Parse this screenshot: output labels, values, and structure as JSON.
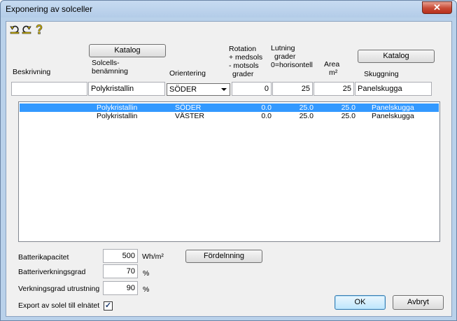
{
  "window": {
    "title": "Exponering av solceller",
    "close_label": "✕"
  },
  "toolbar": {
    "icons": [
      "undo-icon",
      "redo-icon",
      "help-icon"
    ]
  },
  "headers": {
    "katalog_left": "Katalog",
    "katalog_right": "Katalog",
    "beskrivning": "Beskrivning",
    "solcell_l1": "Solcells-",
    "solcell_l2": "benämning",
    "orientering": "Orientering",
    "rotation_l1": "Rotation",
    "rotation_l2": "+ medsols",
    "rotation_l3": "- motsols",
    "rotation_l4": "grader",
    "lutning_l1": "Lutning",
    "lutning_l2": "grader",
    "lutning_l3": "0=horisontell",
    "area_l1": "Area",
    "area_l2": "m²",
    "skuggning": "Skuggning"
  },
  "inputs": {
    "beskrivning": "",
    "solcell": "Polykristallin",
    "orientering": "SÖDER",
    "rotation": "0",
    "lutning": "25",
    "area": "25",
    "skuggning": "Panelskugga"
  },
  "rows": [
    {
      "beskrivning": "",
      "solcell": "Polykristallin",
      "orientering": "SÖDER",
      "rotation": "0.0",
      "lutning": "25.0",
      "area": "25.0",
      "skuggning": "Panelskugga",
      "selected": true
    },
    {
      "beskrivning": "",
      "solcell": "Polykristallin",
      "orientering": "VÄSTER",
      "rotation": "0.0",
      "lutning": "25.0",
      "area": "25.0",
      "skuggning": "Panelskugga",
      "selected": false
    }
  ],
  "bottom": {
    "batterikapacitet_label": "Batterikapacitet",
    "batterikapacitet_value": "500",
    "batterikapacitet_unit": "Wh/m²",
    "fordelning_label": "Fördelnning",
    "batteriverkningsgrad_label": "Batteriverkningsgrad",
    "batteriverkningsgrad_value": "70",
    "batteriverkningsgrad_unit": "%",
    "verkningsgrad_label": "Verkningsgrad utrustning",
    "verkningsgrad_value": "90",
    "verkningsgrad_unit": "%",
    "export_label": "Export av solel till elnätet",
    "export_checked": true,
    "ok_label": "OK",
    "cancel_label": "Avbryt"
  }
}
